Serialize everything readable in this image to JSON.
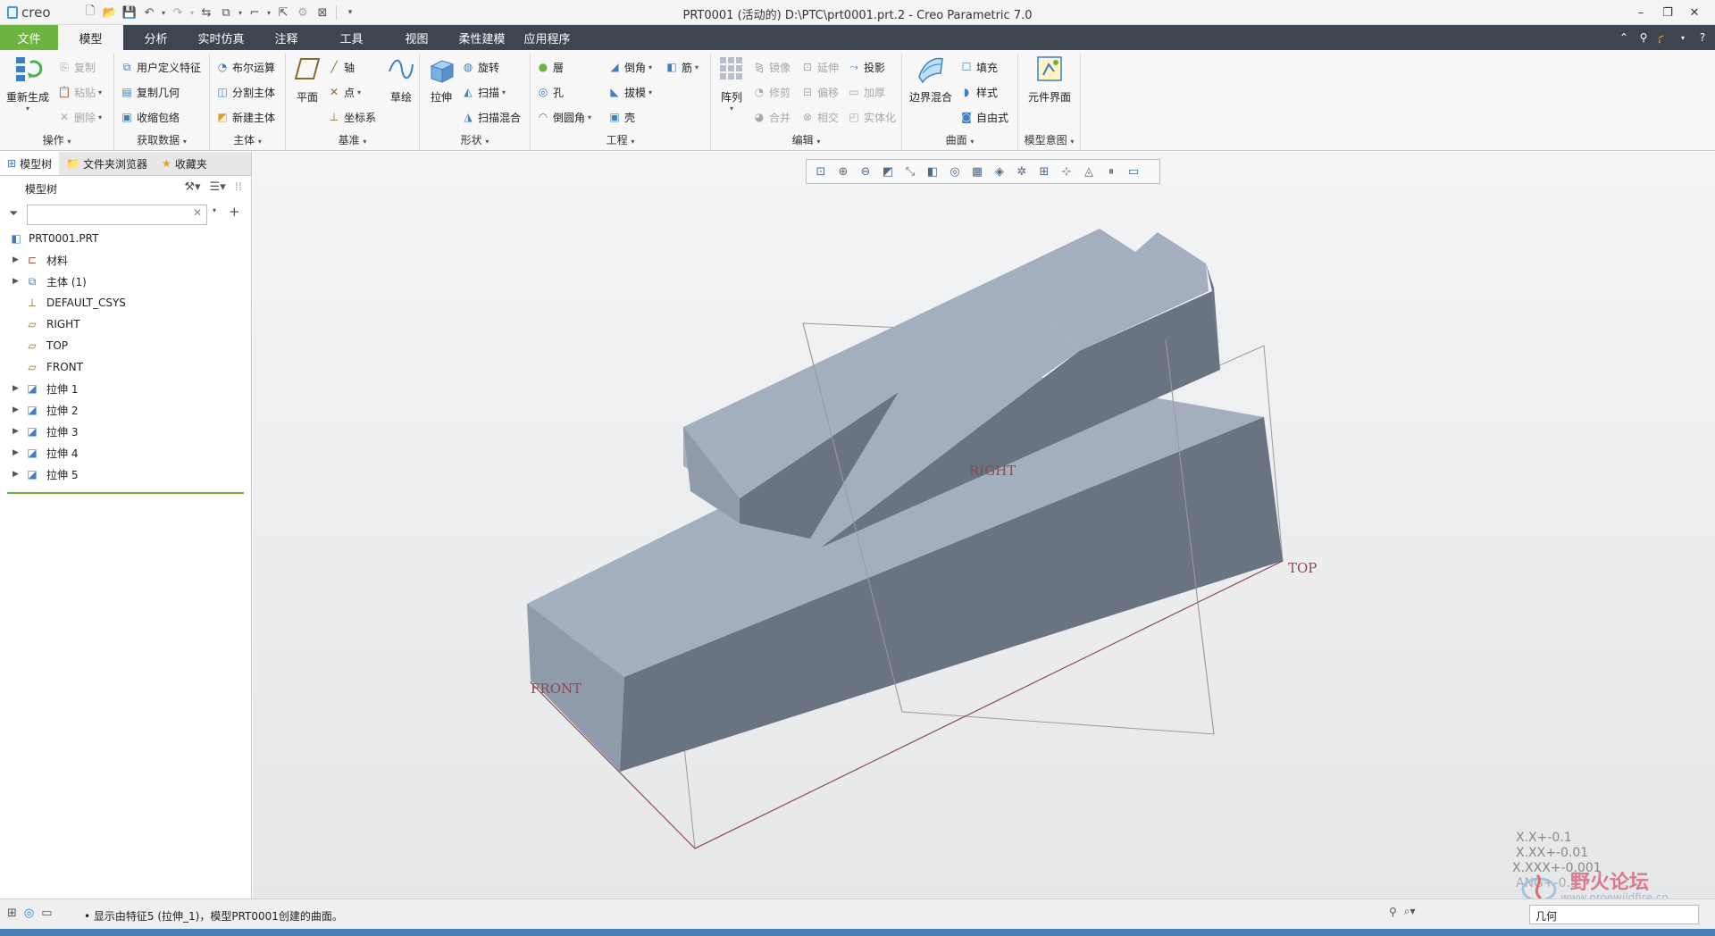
{
  "app": {
    "logo_text": "creo",
    "window_title": "PRT0001 (活动的) D:\\PTC\\prt0001.prt.2 - Creo Parametric 7.0"
  },
  "window_controls": [
    "–",
    "❐",
    "✕"
  ],
  "tabs": [
    {
      "label": "文件"
    },
    {
      "label": "模型"
    },
    {
      "label": "分析"
    },
    {
      "label": "实时仿真"
    },
    {
      "label": "注释"
    },
    {
      "label": "工具"
    },
    {
      "label": "视图"
    },
    {
      "label": "柔性建模"
    },
    {
      "label": "应用程序"
    }
  ],
  "ribbon": {
    "operations": {
      "name": "操作",
      "regenerate": "重新生成",
      "copy": "复制",
      "paste": "粘贴",
      "delete": "删除"
    },
    "get_data": {
      "name": "获取数据",
      "udf": "用户定义特征",
      "copy_geom": "复制几何",
      "shrinkwrap": "收缩包络"
    },
    "body": {
      "name": "主体",
      "boolean": "布尔运算",
      "split": "分割主体",
      "new": "新建主体"
    },
    "datum": {
      "name": "基准",
      "plane": "平面",
      "axis": "轴",
      "point": "点",
      "csys": "坐标系",
      "sketch": "草绘"
    },
    "shapes": {
      "name": "形状",
      "extrude": "拉伸",
      "revolve": "旋转",
      "sweep": "扫描",
      "swept_blend": "扫描混合"
    },
    "engineering": {
      "name": "工程",
      "hole": "孔",
      "round": "倒圆角",
      "chamfer": "倒角",
      "draft": "拔模",
      "shell": "壳",
      "rib": "筋",
      "layer": "層"
    },
    "editing": {
      "name": "编辑",
      "pattern": "阵列",
      "mirror": "镜像",
      "trim": "修剪",
      "merge": "合并",
      "extend": "延伸",
      "offset": "偏移",
      "intersect": "相交",
      "project": "投影",
      "thicken": "加厚",
      "solidify": "实体化"
    },
    "surfaces": {
      "name": "曲面",
      "boundary_blend": "边界混合",
      "fill": "填充",
      "style": "样式",
      "freestyle": "自由式"
    },
    "model_intent": {
      "name": "模型意图",
      "component_interface": "元件界面"
    }
  },
  "sidebar": {
    "tabs": [
      {
        "label": "模型树"
      },
      {
        "label": "文件夹浏览器"
      },
      {
        "label": "收藏夹"
      }
    ],
    "tree_header": "模型树",
    "search_placeholder": "",
    "nodes": [
      {
        "label": "PRT0001.PRT",
        "icon": "part-icon"
      },
      {
        "label": "材料",
        "icon": "material-icon"
      },
      {
        "label": "主体 (1)",
        "icon": "body-icon"
      },
      {
        "label": "DEFAULT_CSYS",
        "icon": "csys-icon"
      },
      {
        "label": "RIGHT",
        "icon": "datum-plane-icon"
      },
      {
        "label": "TOP",
        "icon": "datum-plane-icon"
      },
      {
        "label": "FRONT",
        "icon": "datum-plane-icon"
      },
      {
        "label": "拉伸 1",
        "icon": "extrude-icon"
      },
      {
        "label": "拉伸 2",
        "icon": "extrude-icon"
      },
      {
        "label": "拉伸 3",
        "icon": "extrude-icon"
      },
      {
        "label": "拉伸 4",
        "icon": "extrude-icon"
      },
      {
        "label": "拉伸 5",
        "icon": "extrude-icon"
      }
    ]
  },
  "viewport": {
    "plane_labels": {
      "right": "RIGHT",
      "top": "TOP",
      "front": "FRONT"
    },
    "tolerances": [
      "X.X+-0.1",
      "X.XX+-0.01",
      "X.XXX+-0.001",
      "ANG+-0.5"
    ],
    "model_colors": {
      "light": "#a3afbf",
      "mid": "#8f9aab",
      "dark": "#6a7381",
      "plane": "#8a4a55"
    },
    "watermark_text": "野火论坛",
    "watermark_url": "www.proewildfire.cn"
  },
  "statusbar": {
    "message": "• 显示由特征5 (拉伸_1)，模型PRT0001创建的曲面。",
    "filter_value": "几何"
  }
}
